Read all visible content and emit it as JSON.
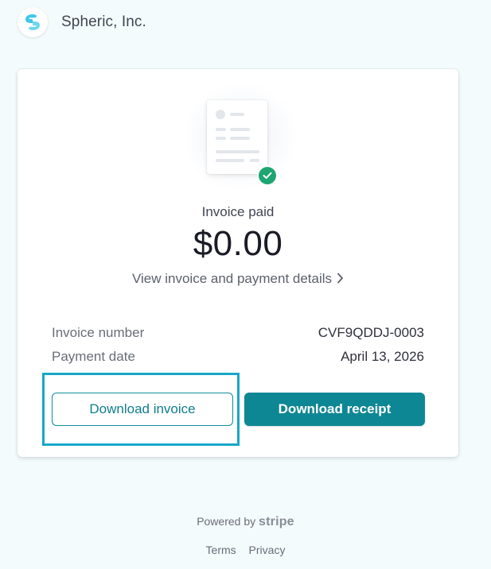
{
  "header": {
    "company_name": "Spheric, Inc."
  },
  "invoice": {
    "status_label": "Invoice paid",
    "amount": "$0.00",
    "details_link": "View invoice and payment details",
    "rows": [
      {
        "label": "Invoice number",
        "value": "CVF9QDDJ-0003"
      },
      {
        "label": "Payment date",
        "value": "April 13, 2026"
      }
    ]
  },
  "actions": {
    "download_invoice": "Download invoice",
    "download_receipt": "Download receipt"
  },
  "footer": {
    "powered_by": "Powered by",
    "brand": "stripe",
    "terms": "Terms",
    "privacy": "Privacy"
  },
  "colors": {
    "accent": "#0e8794",
    "success": "#1ea672",
    "highlight": "#19a7c6"
  }
}
